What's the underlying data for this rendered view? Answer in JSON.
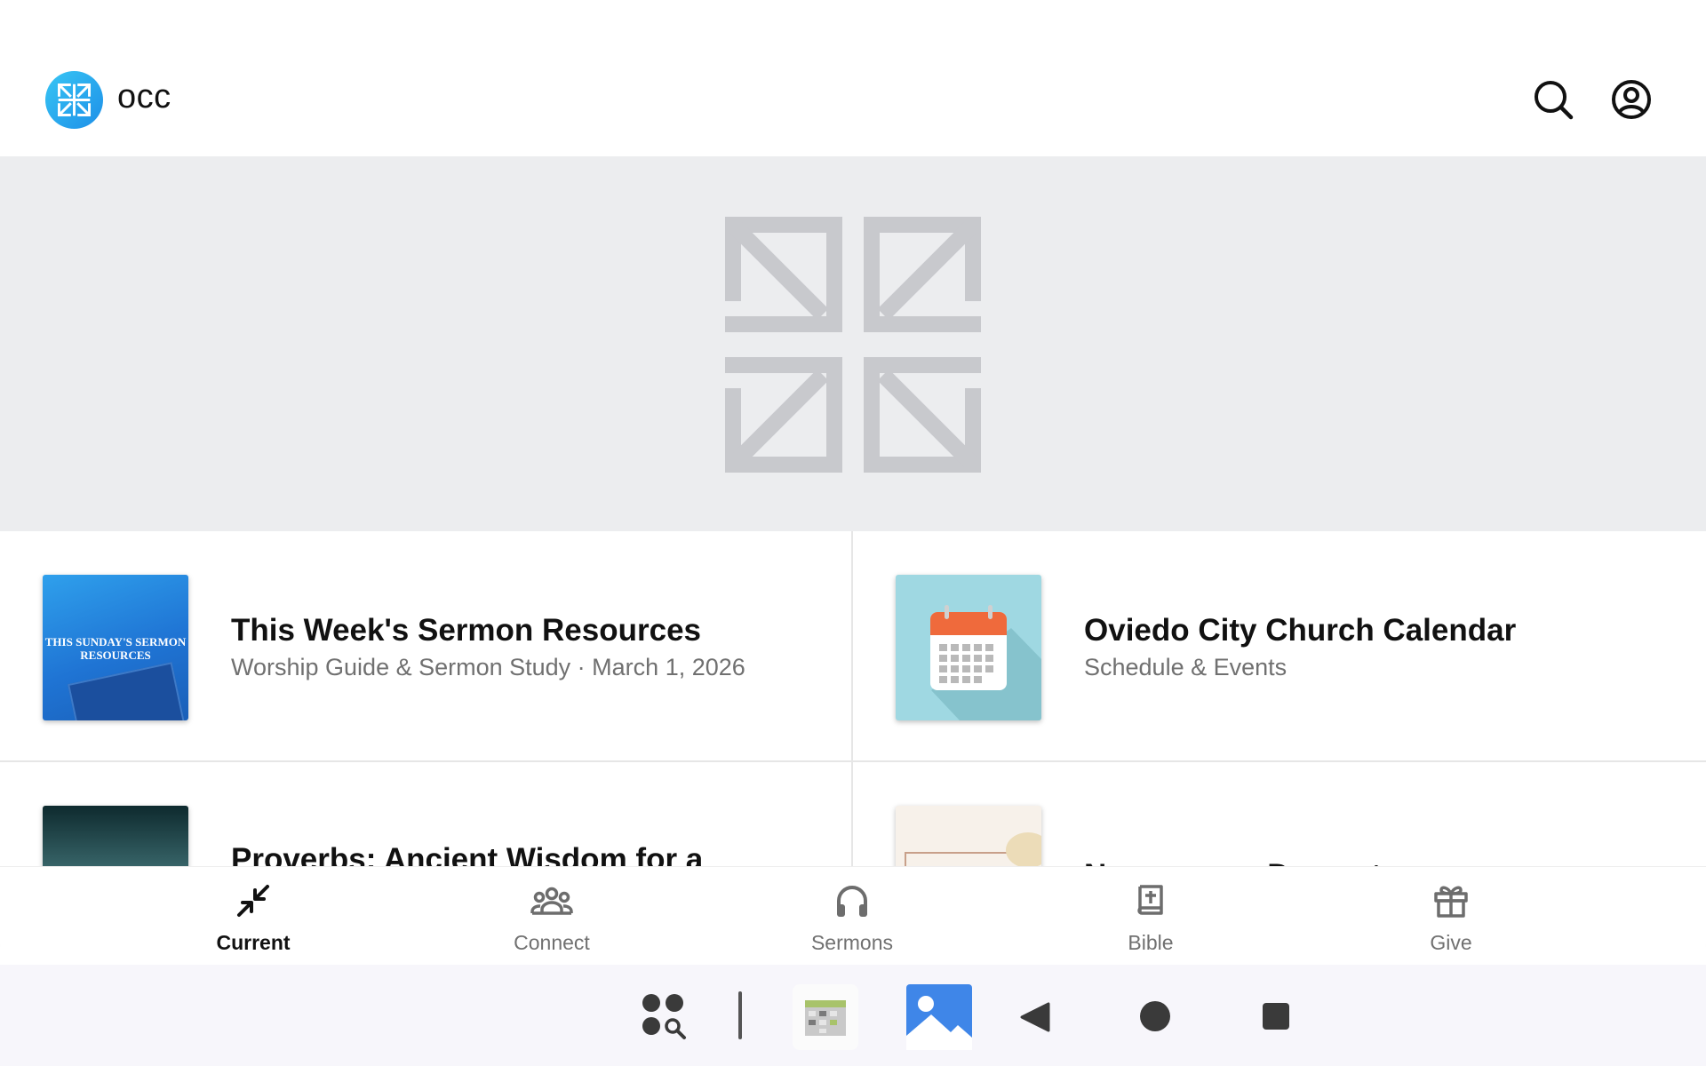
{
  "header": {
    "title": "occ",
    "logo_icon": "church-cross-logo-icon",
    "search_icon": "search-icon",
    "profile_icon": "account-circle-icon"
  },
  "hero": {
    "icon": "church-cross-logo-icon"
  },
  "cards": [
    {
      "title": "This Week's Sermon Resources",
      "subtitle": "Worship Guide & Sermon Study · March 1, 2026",
      "thumb_text": "THIS SUNDAY'S SERMON RESOURCES"
    },
    {
      "title": "Oviedo City Church Calendar",
      "subtitle": "Schedule & Events"
    },
    {
      "title": "Proverbs: Ancient Wisdom for a"
    },
    {
      "title": "Newcomers Dessert"
    }
  ],
  "bottom_nav": {
    "items": [
      {
        "label": "Current",
        "icon": "collapse-arrows-icon",
        "active": true
      },
      {
        "label": "Connect",
        "icon": "group-icon",
        "active": false
      },
      {
        "label": "Sermons",
        "icon": "headphones-icon",
        "active": false
      },
      {
        "label": "Bible",
        "icon": "bible-icon",
        "active": false
      },
      {
        "label": "Give",
        "icon": "gift-icon",
        "active": false
      }
    ]
  },
  "system_bar": {
    "icons": [
      "app-drawer-search-icon",
      "calendar-app-icon",
      "gallery-app-icon",
      "back-icon",
      "home-icon",
      "recents-icon"
    ]
  },
  "colors": {
    "accent": "#1d8fe8",
    "hero_bg": "#ecedef",
    "active_nav": "#111111",
    "inactive_nav": "#707070"
  }
}
